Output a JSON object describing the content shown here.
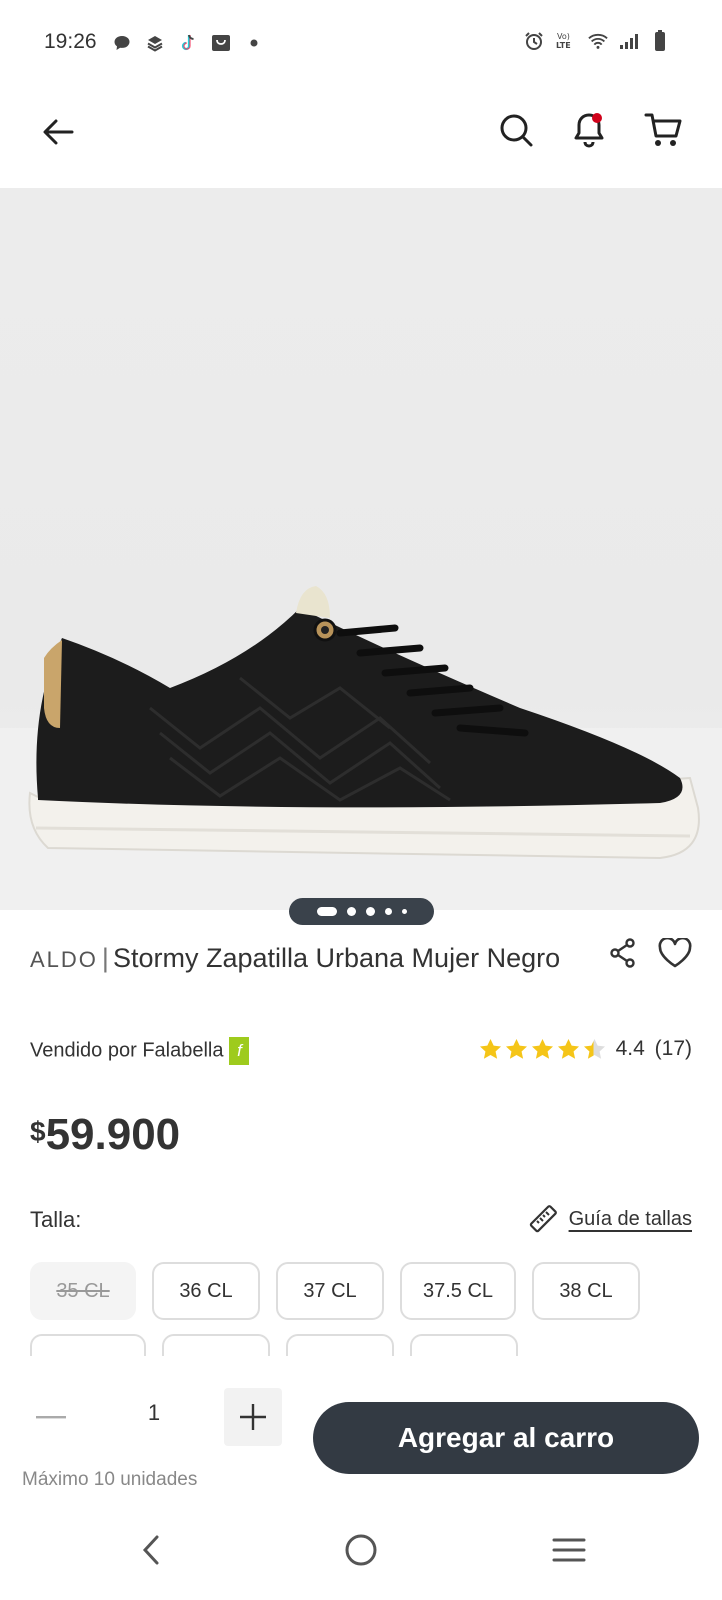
{
  "status_bar": {
    "time": "19:26",
    "left_icons": [
      "chat-bubble-icon",
      "layers-icon",
      "tiktok-icon",
      "shopping-bag-icon",
      "dot-icon"
    ],
    "right_icons": [
      "alarm-icon",
      "volte-icon",
      "wifi-icon",
      "signal-icon",
      "battery-icon"
    ],
    "volte_text": "Vo))\nLTE"
  },
  "header": {
    "icons": [
      "back-arrow-icon",
      "search-icon",
      "bell-icon",
      "cart-icon"
    ],
    "notification_dot_color": "#d0021b"
  },
  "gallery": {
    "image_count": 5,
    "active_index": 0,
    "image_label": "black-sneaker-image"
  },
  "product": {
    "brand": "ALDO",
    "separator": "|",
    "name": "Stormy Zapatilla Urbana Mujer Negro",
    "seller": "Vendido por Falabella",
    "seller_badge": "f",
    "seller_badge_color": "#9ecb1d",
    "rating_value": "4.4",
    "rating_count": "(17)",
    "rating_stars": 4.4,
    "star_color": "#f5c518",
    "price_currency": "$",
    "price_amount": "59.900"
  },
  "sizes": {
    "label": "Talla:",
    "guide_label": "Guía de tallas",
    "options": [
      {
        "label": "35 CL",
        "available": false
      },
      {
        "label": "36 CL",
        "available": true
      },
      {
        "label": "37 CL",
        "available": true
      },
      {
        "label": "37.5 CL",
        "available": true
      },
      {
        "label": "38 CL",
        "available": true
      }
    ]
  },
  "purchase": {
    "quantity": "1",
    "max_units": "Máximo 10 unidades",
    "add_to_cart": "Agregar al carro",
    "button_color": "#333a43"
  },
  "nav_bar": {
    "icons": [
      "nav-back-icon",
      "nav-home-icon",
      "nav-recents-icon"
    ]
  }
}
